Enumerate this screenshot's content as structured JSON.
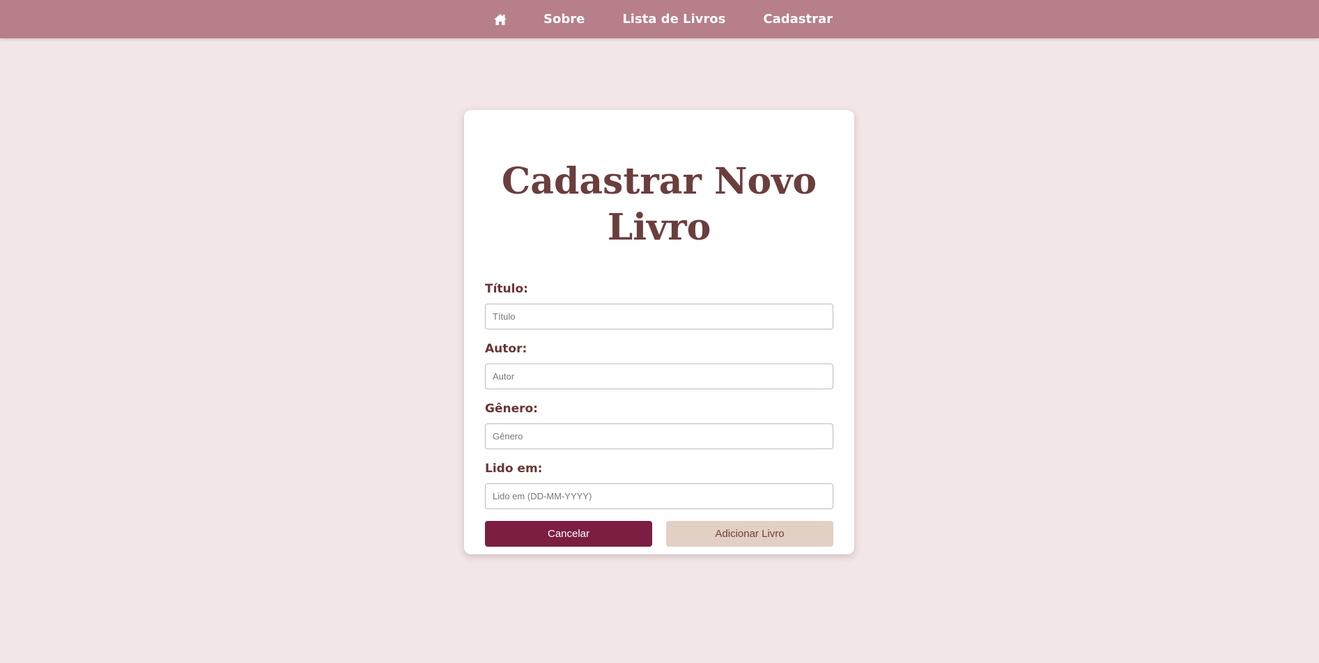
{
  "nav": {
    "home_icon": "home-icon",
    "links": [
      "Sobre",
      "Lista de Livros",
      "Cadastrar"
    ]
  },
  "form": {
    "title": "Cadastrar Novo Livro",
    "fields": [
      {
        "label": "Título:",
        "placeholder": "Título"
      },
      {
        "label": "Autor:",
        "placeholder": "Autor"
      },
      {
        "label": "Gênero:",
        "placeholder": "Gênero"
      },
      {
        "label": "Lido em:",
        "placeholder": "Lido em (DD-MM-YYYY)"
      }
    ],
    "cancel_label": "Cancelar",
    "submit_label": "Adicionar Livro"
  },
  "colors": {
    "navbar": "#b67f89",
    "background": "#f2e6e6",
    "title": "#6b3e3e",
    "cancel_button": "#7b1e42",
    "submit_button": "#e2d0c4"
  }
}
